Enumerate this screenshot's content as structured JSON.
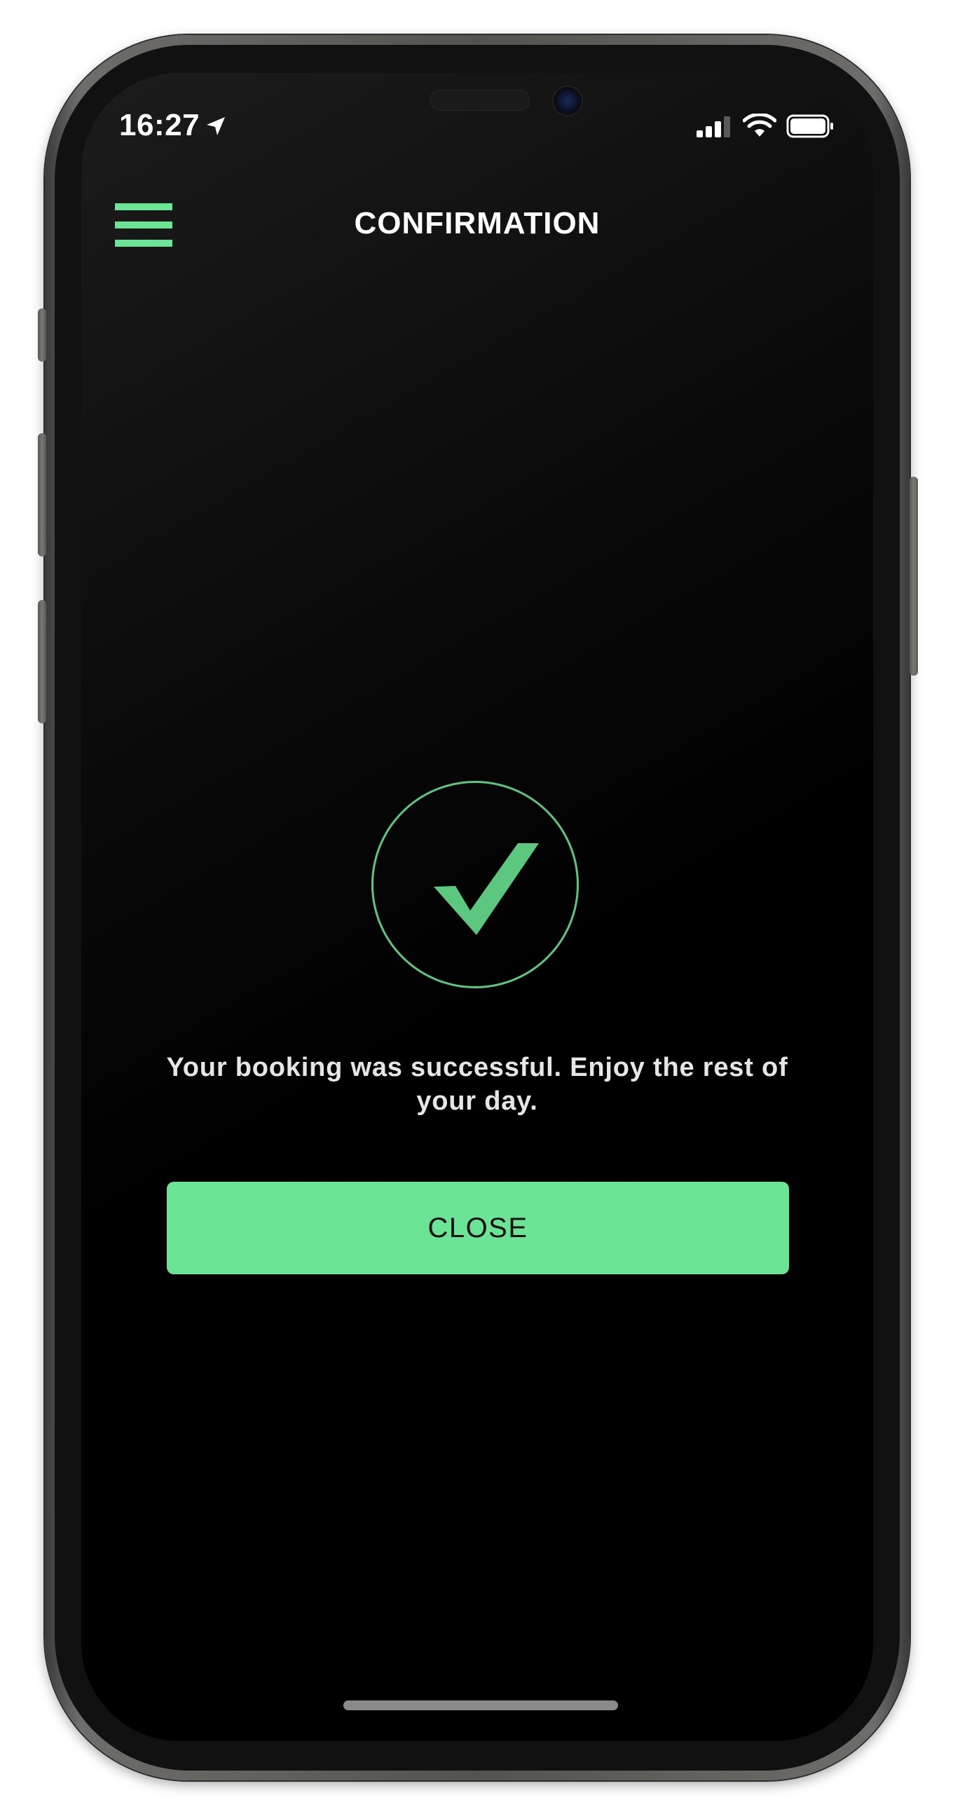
{
  "status_bar": {
    "time": "16:27",
    "location_icon": "location-arrow-icon",
    "signal_icon": "cellular-signal-icon",
    "wifi_icon": "wifi-icon",
    "battery_icon": "battery-icon"
  },
  "header": {
    "title": "CONFIRMATION",
    "menu_icon": "hamburger-menu-icon"
  },
  "confirmation": {
    "icon": "checkmark-icon",
    "message": "Your booking was successful. Enjoy the rest of your day.",
    "close_label": "CLOSE"
  },
  "colors": {
    "accent": "#6be495",
    "background": "#000000",
    "text": "#e6e6e6"
  }
}
